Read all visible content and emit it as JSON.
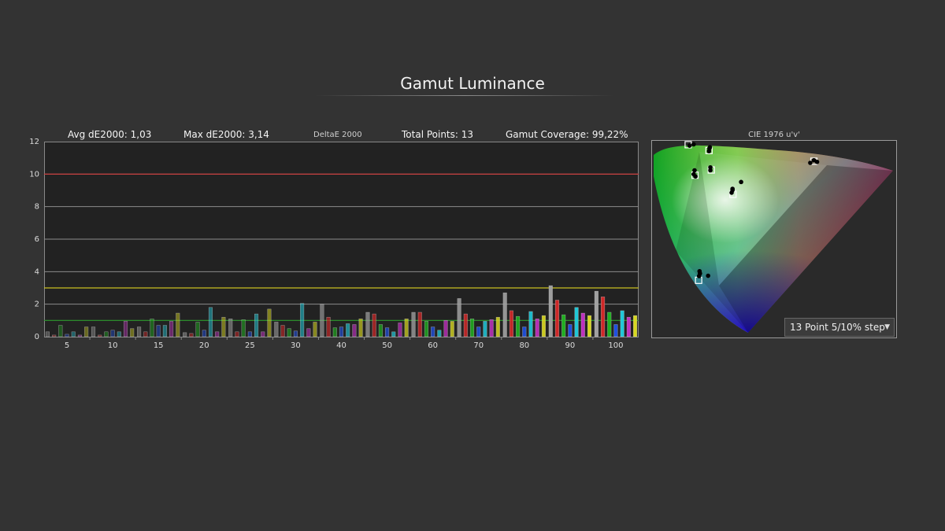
{
  "page": {
    "title": "Gamut Luminance"
  },
  "stats": {
    "avg": "Avg dE2000: 1,03",
    "max": "Max dE2000: 3,14",
    "metric": "DeltaE 2000",
    "points": "Total Points: 13",
    "coverage": "Gamut Coverage: 99,22%"
  },
  "cie": {
    "title": "CIE 1976 u'v'",
    "step_label": "13 Point 5/10% step",
    "step_arrow": "▼"
  },
  "chart_data": {
    "type": "bar",
    "ylim": [
      0,
      12
    ],
    "yticks": [
      0,
      2,
      4,
      6,
      8,
      10,
      12
    ],
    "threshold_lines": [
      {
        "value": 10,
        "color": "#d33a3a"
      },
      {
        "value": 3,
        "color": "#c9c021"
      },
      {
        "value": 1,
        "color": "#2e9a2e"
      }
    ],
    "categories": [
      "5",
      "10",
      "15",
      "20",
      "25",
      "30",
      "40",
      "50",
      "60",
      "70",
      "80",
      "90",
      "100"
    ],
    "series": [
      {
        "color": "#a0a0a0",
        "values": [
          0.3,
          0.6,
          0.6,
          0.25,
          1.1,
          0.9,
          2.0,
          1.5,
          1.5,
          2.35,
          2.7,
          3.14,
          2.8
        ]
      },
      {
        "color": "#d02828",
        "values": [
          0.1,
          0.1,
          0.3,
          0.2,
          0.3,
          0.7,
          1.2,
          1.4,
          1.5,
          1.4,
          1.6,
          2.25,
          2.45
        ]
      },
      {
        "color": "#20b020",
        "values": [
          0.7,
          0.3,
          1.1,
          0.9,
          1.05,
          0.5,
          0.55,
          0.75,
          0.95,
          1.1,
          1.25,
          1.35,
          1.5
        ]
      },
      {
        "color": "#2050e0",
        "values": [
          0.15,
          0.4,
          0.7,
          0.4,
          0.3,
          0.35,
          0.6,
          0.55,
          0.6,
          0.6,
          0.6,
          0.75,
          0.75
        ]
      },
      {
        "color": "#20c8d8",
        "values": [
          0.3,
          0.3,
          0.7,
          1.8,
          1.4,
          2.05,
          0.8,
          0.3,
          0.4,
          0.95,
          1.55,
          1.8,
          1.6
        ]
      },
      {
        "color": "#c030c0",
        "values": [
          0.1,
          0.95,
          0.95,
          0.3,
          0.3,
          0.5,
          0.75,
          0.85,
          1.0,
          1.05,
          1.1,
          1.45,
          1.2
        ]
      },
      {
        "color": "#d8d820",
        "values": [
          0.6,
          0.5,
          1.45,
          1.2,
          1.7,
          0.9,
          1.1,
          1.1,
          0.95,
          1.2,
          1.3,
          1.3,
          1.3
        ]
      }
    ]
  },
  "cie_points": {
    "targets": [
      [
        0.16,
        0.576
      ],
      [
        0.206,
        0.558
      ],
      [
        0.175,
        0.482
      ],
      [
        0.211,
        0.498
      ],
      [
        0.438,
        0.525
      ],
      [
        0.259,
        0.423
      ],
      [
        0.183,
        0.158
      ]
    ],
    "measured": [
      [
        0.163,
        0.573
      ],
      [
        0.172,
        0.577
      ],
      [
        0.207,
        0.565
      ],
      [
        0.208,
        0.568
      ],
      [
        0.206,
        0.556
      ],
      [
        0.174,
        0.497
      ],
      [
        0.172,
        0.485
      ],
      [
        0.176,
        0.478
      ],
      [
        0.209,
        0.506
      ],
      [
        0.209,
        0.497
      ],
      [
        0.43,
        0.52
      ],
      [
        0.438,
        0.528
      ],
      [
        0.445,
        0.523
      ],
      [
        0.277,
        0.461
      ],
      [
        0.258,
        0.436
      ],
      [
        0.258,
        0.44
      ],
      [
        0.256,
        0.428
      ],
      [
        0.185,
        0.186
      ],
      [
        0.186,
        0.179
      ],
      [
        0.184,
        0.171
      ],
      [
        0.204,
        0.172
      ]
    ]
  },
  "colors": {
    "background": "#333333",
    "plot_bg": "#222222",
    "grid": "#8c8c8c"
  }
}
